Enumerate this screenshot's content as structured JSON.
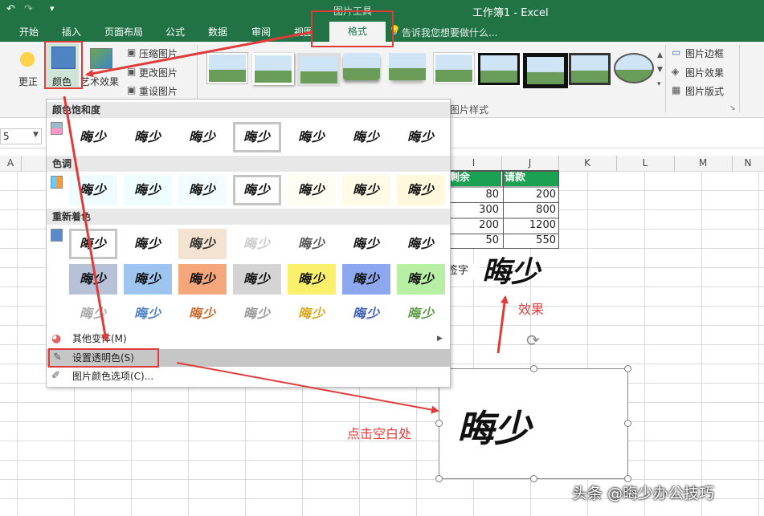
{
  "window": {
    "title": "工作簿1 - Excel",
    "context_tab_group": "图片工具"
  },
  "tabs": [
    "开始",
    "插入",
    "页面布局",
    "公式",
    "数据",
    "审阅",
    "视图",
    "格式"
  ],
  "tell_me": "告诉我您想要做什么...",
  "ribbon": {
    "correct_label": "更正",
    "color_label": "颜色",
    "artistic_label": "艺术效果",
    "compress_label": "压缩图片",
    "change_label": "更改图片",
    "reset_label": "重设图片",
    "picture_border": "图片边框",
    "picture_effect": "图片效果",
    "picture_layout": "图片版式",
    "styles_group": "图片样式"
  },
  "name_box": "5",
  "columns": [
    "A",
    "I",
    "J",
    "K",
    "L",
    "M",
    "N"
  ],
  "table": {
    "headers": [
      "剩余",
      "请款"
    ],
    "rows": [
      [
        "80",
        "200"
      ],
      [
        "300",
        "800"
      ],
      [
        "200",
        "1200"
      ],
      [
        "50",
        "550"
      ]
    ],
    "extra_text": "签字"
  },
  "menu": {
    "saturation_header": "颜色饱和度",
    "tone_header": "色调",
    "recolor_header": "重新着色",
    "swatch_text": "晦少",
    "more_variants": "其他变体(M)",
    "set_transparent": "设置透明色(S)",
    "picture_color_options": "图片颜色选项(C)..."
  },
  "annotations": {
    "effect": "效果",
    "click_blank": "点击空白处"
  },
  "signature": "晦少",
  "watermark": "头条 @晦少办公技巧",
  "colors": {
    "excel_green": "#217346",
    "header_green": "#1aa151",
    "annot_red": "#e03b3b"
  }
}
